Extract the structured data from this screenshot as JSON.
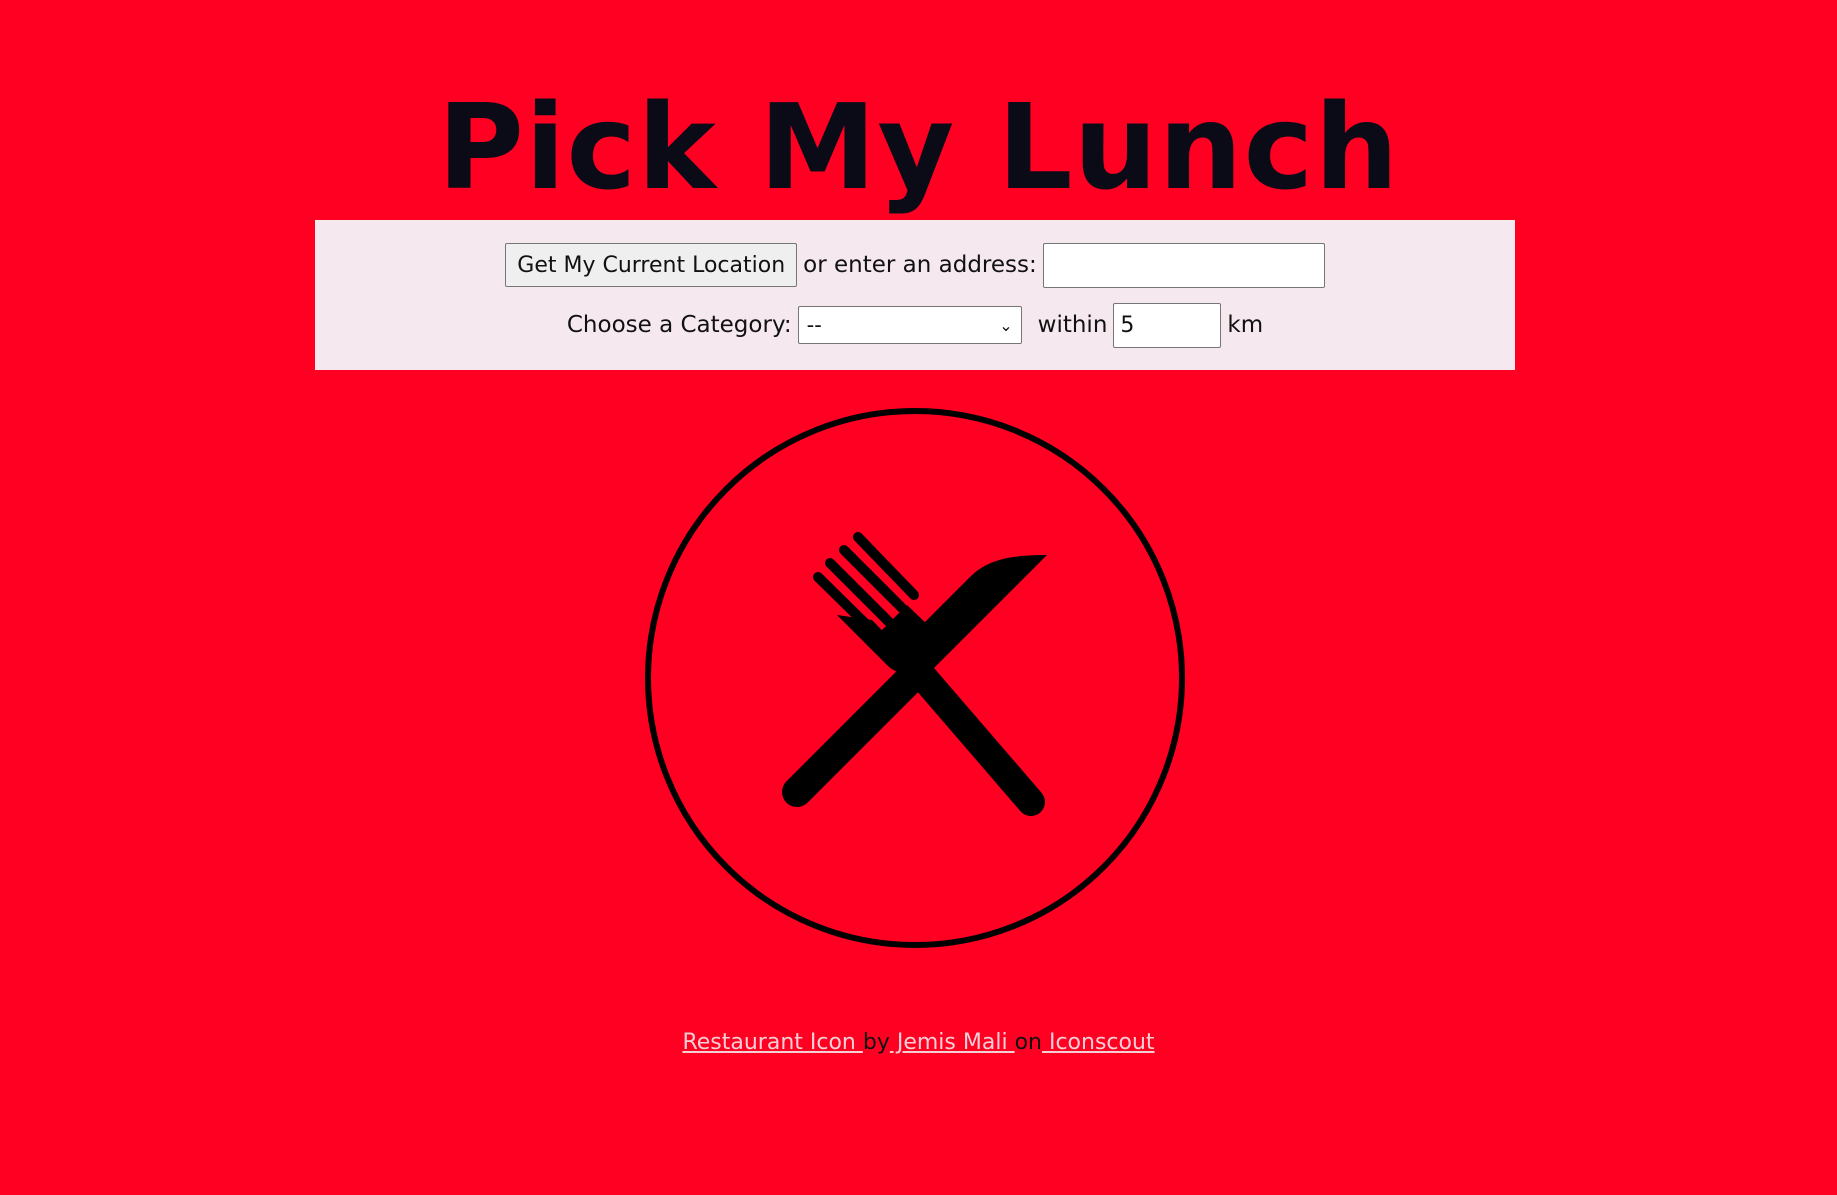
{
  "page": {
    "title": "Pick My Lunch",
    "background_color": "#ff0022",
    "panel_color": "#f6e8ef"
  },
  "location_row": {
    "button_label": "Get My Current Location",
    "address_label": "or enter an address:",
    "address_value": ""
  },
  "category_row": {
    "category_label": "Choose a Category:",
    "category_selected": "--",
    "within_label": "within",
    "distance_value": "5",
    "unit_label": "km"
  },
  "hero": {
    "icon": "restaurant-fork-knife-icon"
  },
  "credit": {
    "link1": "Restaurant Icon ",
    "sep1": "by",
    "link2": " Jemis Mali ",
    "sep2": "on",
    "link3": " Iconscout"
  }
}
